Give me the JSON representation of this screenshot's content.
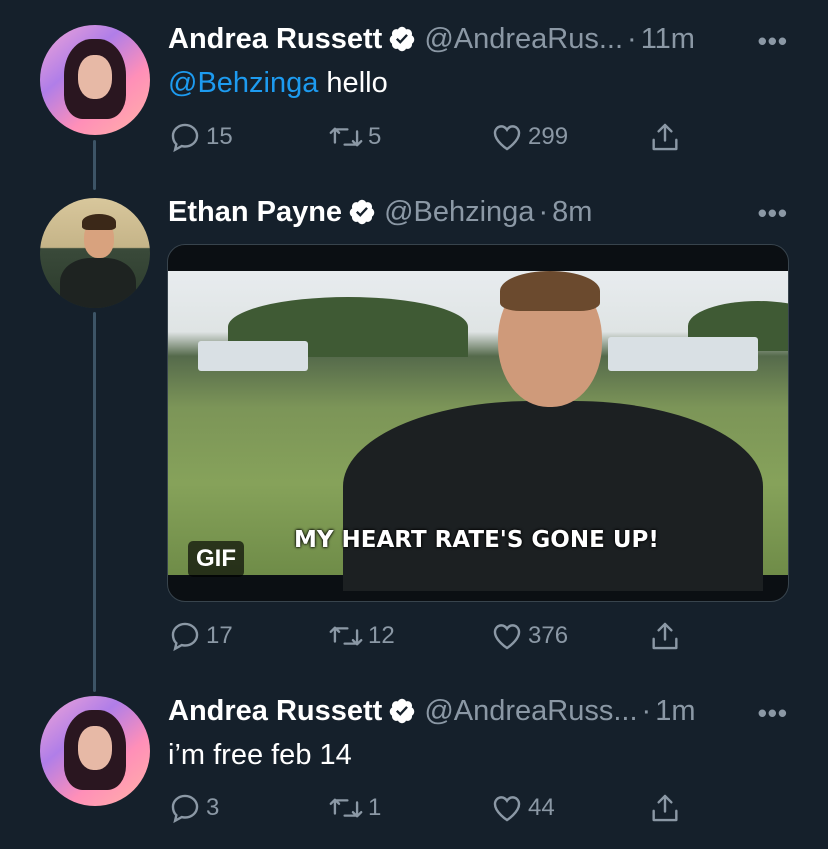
{
  "tweets": [
    {
      "name": "Andrea Russett",
      "handle": "@AndreaRus...",
      "dot": "·",
      "time": "11m",
      "mention": "@Behzinga",
      "text": " hello",
      "replies": "15",
      "retweets": "5",
      "likes": "299"
    },
    {
      "name": "Ethan Payne",
      "handle": "@Behzinga",
      "dot": "·",
      "time": "8m",
      "media": {
        "caption": "MY HEART RATE'S GONE UP!",
        "badge": "GIF"
      },
      "replies": "17",
      "retweets": "12",
      "likes": "376"
    },
    {
      "name": "Andrea Russett",
      "handle": "@AndreaRuss...",
      "dot": "·",
      "time": "1m",
      "text": "i’m free feb 14",
      "replies": "3",
      "retweets": "1",
      "likes": "44"
    }
  ],
  "more_label": "•••",
  "colors": {
    "background": "#15202b",
    "accent": "#1d9bf0",
    "secondary_text": "#8b98a5",
    "thread_line": "#3d5466"
  }
}
